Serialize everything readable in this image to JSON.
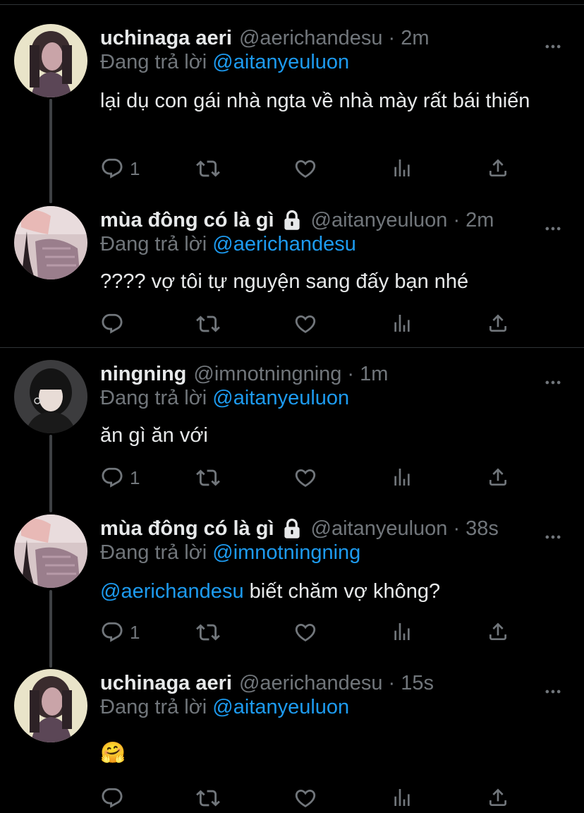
{
  "replying_prefix": "Đang trả lời",
  "tweets": [
    {
      "name": "uchinaga aeri",
      "locked": false,
      "handle": "@aerichandesu",
      "time": "2m",
      "reply_to": "@aitanyeuluon",
      "text": "lại dụ con gái nhà ngta về nhà mày rất bái thiến",
      "reply_count": "1"
    },
    {
      "name": "mùa đông có là gì",
      "locked": true,
      "handle": "@aitanyeuluon",
      "time": "2m",
      "reply_to": "@aerichandesu",
      "text": "???? vợ tôi tự nguyện sang đấy bạn nhé",
      "reply_count": ""
    },
    {
      "name": "ningning",
      "locked": false,
      "handle": "@imnotningning",
      "time": "1m",
      "reply_to": "@aitanyeuluon",
      "text": "ăn gì ăn với",
      "reply_count": "1"
    },
    {
      "name": "mùa đông có là gì",
      "locked": true,
      "handle": "@aitanyeuluon",
      "time": "38s",
      "reply_to": "@imnotningning",
      "text_mention": "@aerichandesu",
      "text": " biết chăm vợ không?",
      "reply_count": "1"
    },
    {
      "name": "uchinaga aeri",
      "locked": false,
      "handle": "@aerichandesu",
      "time": "15s",
      "reply_to": "@aitanyeuluon",
      "text": "🤗",
      "reply_count": ""
    }
  ],
  "icons": {
    "reply": "reply-icon",
    "retweet": "retweet-icon",
    "like": "heart-icon",
    "analytics": "analytics-icon",
    "share": "share-icon",
    "more": "more-icon",
    "lock": "lock-icon"
  },
  "colors": {
    "background": "#000000",
    "text": "#e7e9ea",
    "muted": "#71767b",
    "mention": "#1d9bf0",
    "divider": "#2f3336"
  }
}
